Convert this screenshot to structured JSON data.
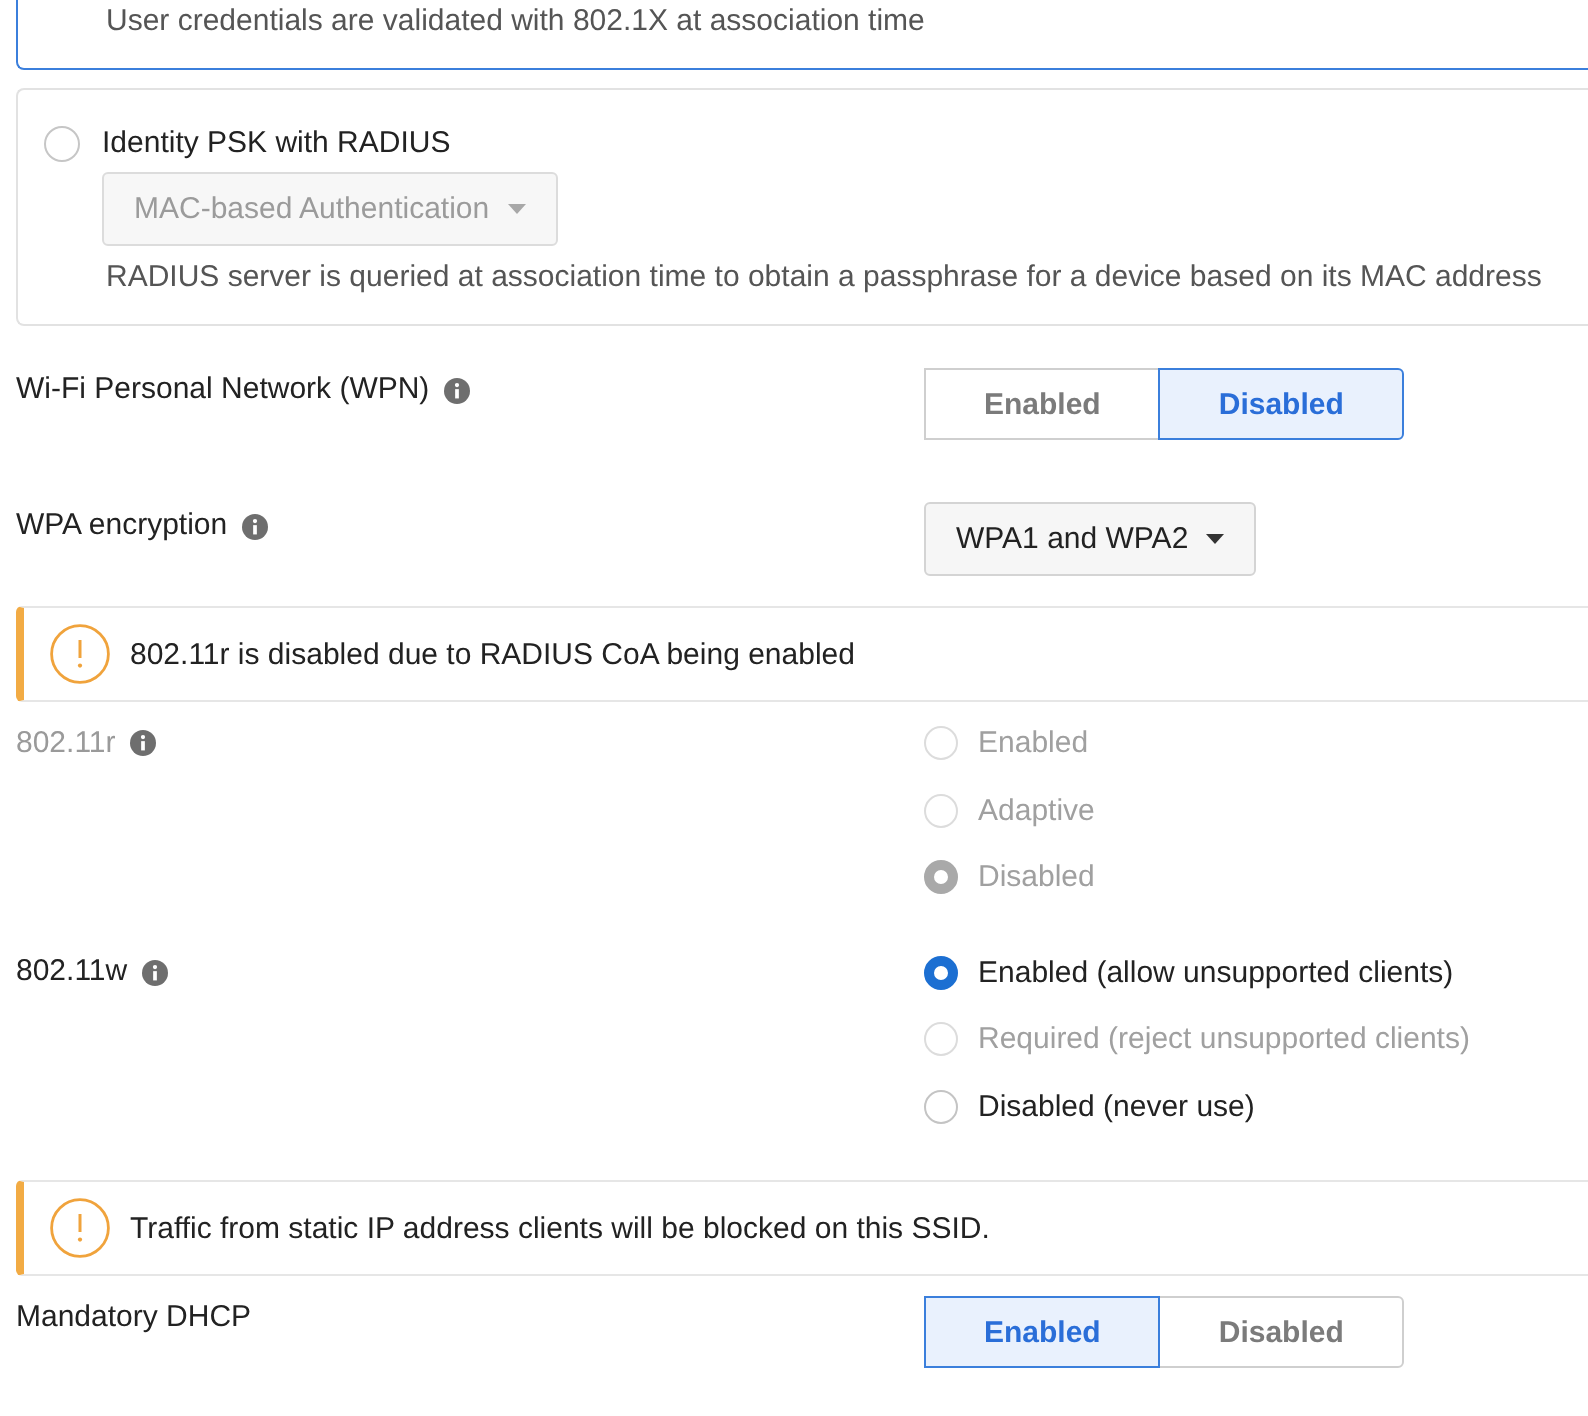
{
  "auth_options": [
    {
      "selected": true,
      "description": "User credentials are validated with 802.1X at association time"
    },
    {
      "selected": false,
      "title": "Identity PSK with RADIUS",
      "dropdown": {
        "value": "MAC-based Authentication",
        "disabled": true
      },
      "description": "RADIUS server is queried at association time to obtain a passphrase for a device based on its MAC address"
    }
  ],
  "settings": [
    {
      "kind": "toggle",
      "label": "Wi-Fi Personal Network (WPN)",
      "info": true,
      "options": [
        {
          "label": "Enabled",
          "selected": false
        },
        {
          "label": "Disabled",
          "selected": true
        }
      ]
    },
    {
      "kind": "dropdown",
      "label": "WPA encryption",
      "info": true,
      "value": "WPA1 and WPA2"
    },
    {
      "kind": "alert",
      "text": "802.11r is disabled due to RADIUS CoA being enabled"
    },
    {
      "kind": "radios",
      "label": "802.11r",
      "info": true,
      "disabled": true,
      "options": [
        {
          "label": "Enabled",
          "selected": false,
          "disabled": true
        },
        {
          "label": "Adaptive",
          "selected": false,
          "disabled": true
        },
        {
          "label": "Disabled",
          "selected": true,
          "disabled": true
        }
      ]
    },
    {
      "kind": "radios",
      "label": "802.11w",
      "info": true,
      "disabled": false,
      "options": [
        {
          "label": "Enabled (allow unsupported clients)",
          "selected": true,
          "disabled": false
        },
        {
          "label": "Required (reject unsupported clients)",
          "selected": false,
          "disabled": true
        },
        {
          "label": "Disabled (never use)",
          "selected": false,
          "disabled": false
        }
      ]
    },
    {
      "kind": "alert",
      "text": "Traffic from static IP address clients will be blocked on this SSID."
    },
    {
      "kind": "toggle",
      "label": "Mandatory DHCP",
      "options": [
        {
          "label": "Enabled",
          "selected": true
        },
        {
          "label": "Disabled",
          "selected": false
        }
      ]
    }
  ]
}
